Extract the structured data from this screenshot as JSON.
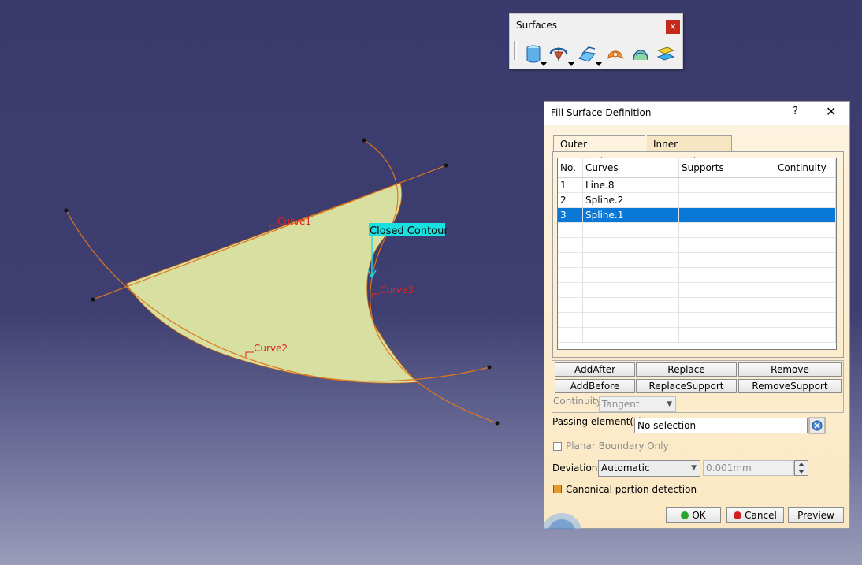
{
  "toolbar": {
    "title": "Surfaces",
    "close_label": "×",
    "icons": [
      "extrude-icon",
      "revolve-icon",
      "offset-icon",
      "fill-icon",
      "multi-section-icon",
      "blend-icon"
    ]
  },
  "viewport": {
    "labels": {
      "curve1": "Curve1",
      "curve2": "Curve2",
      "curve3": "Curve3",
      "closed_contour": "Closed Contour"
    },
    "colors": {
      "surface_fill": "#d7e0a0",
      "curve": "#e0761e",
      "label": "#e32222",
      "contour_tag": "#19e0e0"
    }
  },
  "dialog": {
    "title": "Fill Surface Definition",
    "help_label": "?",
    "close_label": "✕",
    "tabs": [
      "Outer Boundaries",
      "Inner Boundaries"
    ],
    "table": {
      "headers": [
        "No.",
        "Curves",
        "Supports",
        "Continuity"
      ],
      "rows": [
        {
          "no": "1",
          "curve": "Line.8",
          "support": "",
          "continuity": ""
        },
        {
          "no": "2",
          "curve": "Spline.2",
          "support": "",
          "continuity": ""
        },
        {
          "no": "3",
          "curve": "Spline.1",
          "support": "",
          "continuity": ""
        }
      ]
    },
    "buttons": {
      "add_after": "AddAfter",
      "replace": "Replace",
      "remove": "Remove",
      "add_before": "AddBefore",
      "replace_support": "ReplaceSupport",
      "remove_support": "RemoveSupport"
    },
    "continuity_label": "Continuity:",
    "continuity_value": "Tangent",
    "passing_label": "Passing element(s):",
    "passing_value": "No selection",
    "planar_label": "Planar Boundary Only",
    "deviation_label": "Deviation:",
    "deviation_mode": "Automatic",
    "deviation_value": "0.001mm",
    "canonical_label": "Canonical portion detection",
    "ok_label": "OK",
    "cancel_label": "Cancel",
    "preview_label": "Preview"
  }
}
